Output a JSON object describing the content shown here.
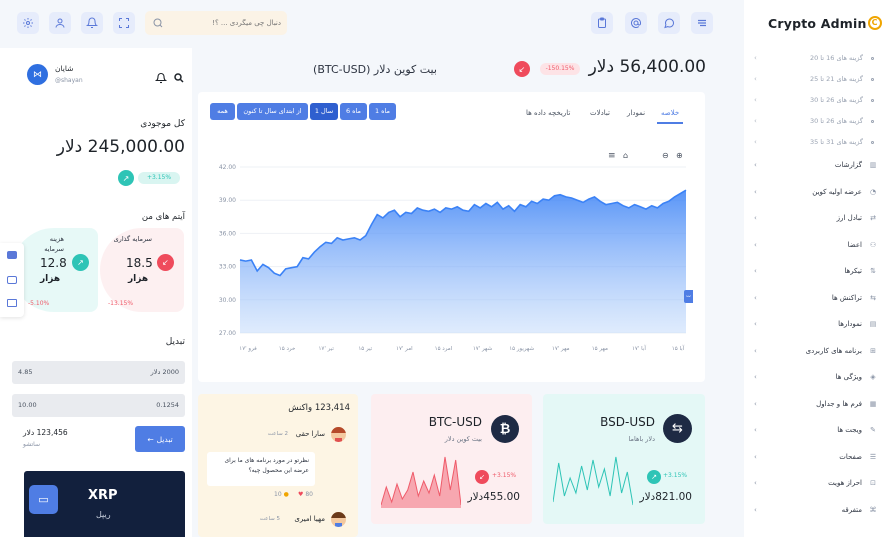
{
  "header": {
    "search_placeholder": "دنبال چی میگردی ... ؟!",
    "brand": "Crypto Admin"
  },
  "sidebar": {
    "subitems": [
      {
        "label": "گزینه های 16 تا 20"
      },
      {
        "label": "گزینه های 21 تا 25"
      },
      {
        "label": "گزینه های 26 تا 30"
      },
      {
        "label": "گزینه های 26 تا 30"
      },
      {
        "label": "گزینه های 31 تا 35"
      }
    ],
    "items": [
      {
        "label": "گزارشات",
        "icon": "bar-chart-icon"
      },
      {
        "label": "عرضه اولیه کوین",
        "icon": "pie-chart-icon"
      },
      {
        "label": "تبادل ارز",
        "icon": "exchange-icon"
      },
      {
        "label": "اعضا",
        "icon": "users-icon"
      },
      {
        "label": "تیکرها",
        "icon": "ticker-icon"
      },
      {
        "label": "تراکنش ها",
        "icon": "transactions-icon"
      },
      {
        "label": "نمودارها",
        "icon": "chart-icon"
      },
      {
        "label": "برنامه های کاربردی",
        "icon": "apps-icon"
      },
      {
        "label": "ویژگی ها",
        "icon": "box-icon"
      },
      {
        "label": "فرم ها و جداول",
        "icon": "form-icon"
      },
      {
        "label": "ویجت ها",
        "icon": "widget-icon"
      },
      {
        "label": "صفحات",
        "icon": "pages-icon"
      },
      {
        "label": "احراز هویت",
        "icon": "lock-icon"
      },
      {
        "label": "متفرقه",
        "icon": "misc-icon"
      }
    ]
  },
  "market": {
    "price": "56,400.00 دلار",
    "change": "-150.15%",
    "pair": "بیت کوین دلار (BTC-USD)",
    "tabs": [
      "خلاصه",
      "نمودار",
      "تبادلات",
      "تاریخچه داده ها"
    ],
    "ranges": [
      "1 ماه",
      "6 ماه",
      "1 سال",
      "از ابتدای سال تا کنون",
      "همه"
    ]
  },
  "chart_data": {
    "type": "area",
    "y_ticks": [
      "42.00",
      "39.00",
      "36.00",
      "33.00",
      "30.00",
      "27.00"
    ],
    "ylim": [
      27,
      42
    ],
    "x_ticks": [
      "فرو '۱۷",
      "خرد ۱۵",
      "تیر '۱۷",
      "تیر ۱۵",
      "امر '۱۷",
      "امرد ۱۵",
      "شهر '۱۷",
      "شهریور ۱۵",
      "مهر '۱۷",
      "مهر ۱۵",
      "آبا '۱۷",
      "آبا ۱۵"
    ],
    "values": [
      33.6,
      33.5,
      33.6,
      32.6,
      33.2,
      32.9,
      32.4,
      32.2,
      32.8,
      32.9,
      33.0,
      33.8,
      33.7,
      34.3,
      34.8,
      35.2,
      35.1,
      35.6,
      35.4,
      35.5,
      35.6,
      35.4,
      35.8,
      36.8,
      37.7,
      37.4,
      37.9,
      38.1,
      37.5,
      37.9,
      37.8,
      38.3,
      38.1,
      38.0,
      38.2,
      37.9,
      38.3,
      38.2,
      38.4,
      38.1,
      38.0,
      38.6,
      38.3,
      38.7,
      38.4,
      38.8,
      38.2,
      38.5,
      38.0,
      38.6,
      38.4,
      38.9,
      38.7,
      39.1,
      39.0,
      39.4,
      39.5,
      39.3,
      39.2,
      39.0,
      38.8,
      39.1,
      39.3,
      38.9,
      38.6,
      38.7,
      38.8,
      38.5,
      38.3,
      38.6,
      38.4,
      38.2,
      38.5,
      38.3,
      38.7,
      38.9,
      39.3,
      39.6,
      39.9
    ],
    "line_color": "#3b82f6"
  },
  "profile": {
    "name": "شایان",
    "handle": "@shayan",
    "balance_label": "کل موجودی",
    "balance": "245,000.00 دلار",
    "balance_change": "+3.15%",
    "my_items_label": "آیتم های من",
    "invest_label": "سرمایه گذاری",
    "invest_value": "18.5",
    "invest_unit": "هزار",
    "invest_change": "-13.15%",
    "cost_label": "هزینه سرمایه",
    "cost_value": "12.8",
    "cost_unit": "هزار",
    "cost_change": "-5.10%"
  },
  "convert": {
    "title": "تبدیل",
    "row1_left": "4.85",
    "row1_right": "2000 دلار",
    "row2_left": "10.00",
    "row2_right": "0.1254",
    "amount": "123,456 دلار",
    "amount_sub": "ساتشو",
    "button": "تبدیل"
  },
  "xrp": {
    "name": "XRP",
    "sub": "ریپل"
  },
  "reactions": {
    "title": "123,414 واکنش",
    "user1": "سارا حقی",
    "user1_time": "2 ساعت",
    "comment": "نظرتو در مورد برنامه های ما برای عرضه این محصول چیه؟",
    "likes": "80",
    "replies": "10",
    "user2": "مهیا امیری",
    "user2_time": "5 ساعت"
  },
  "btc_card": {
    "symbol": "BTC-USD",
    "name": "بیت کوین دلار",
    "change": "+3.15%",
    "price": "455.00دلار",
    "color": "#ef5b6a"
  },
  "bsd_card": {
    "symbol": "BSD-USD",
    "name": "دلار باهاما",
    "change": "+3.15%",
    "price": "821.00دلار",
    "color": "#2ec4b6"
  }
}
